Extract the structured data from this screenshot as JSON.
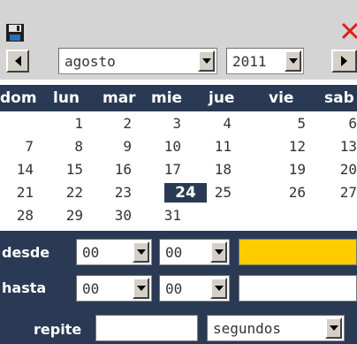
{
  "toolbar": {
    "save_icon": "floppy-disk-icon",
    "close_icon": "close-x-icon",
    "close_color": "#e0201a"
  },
  "navigation": {
    "month_value": "agosto",
    "year_value": "2011",
    "prev_icon": "left-arrow-icon",
    "next_icon": "right-arrow-icon"
  },
  "calendar": {
    "weekdays": [
      "dom",
      "lun",
      "mar",
      "mie",
      "jue",
      "vie",
      "sab"
    ],
    "weeks": [
      [
        "",
        "1",
        "2",
        "3",
        "4",
        "5",
        "6"
      ],
      [
        "7",
        "8",
        "9",
        "10",
        "11",
        "12",
        "13"
      ],
      [
        "14",
        "15",
        "16",
        "17",
        "18",
        "19",
        "20"
      ],
      [
        "21",
        "22",
        "23",
        "24",
        "25",
        "26",
        "27"
      ],
      [
        "28",
        "29",
        "30",
        "31",
        "",
        "",
        ""
      ]
    ],
    "selected_day": "24",
    "header_color": "#2a3a55"
  },
  "time": {
    "desde_label": "desde",
    "desde_hour": "00",
    "desde_minute": "00",
    "desde_value": "",
    "desde_field_color": "#ffcc00",
    "hasta_label": "hasta",
    "hasta_hour": "00",
    "hasta_minute": "00",
    "hasta_value": "",
    "repite_label": "repite",
    "repite_value": "",
    "repite_unit": "segundos"
  }
}
